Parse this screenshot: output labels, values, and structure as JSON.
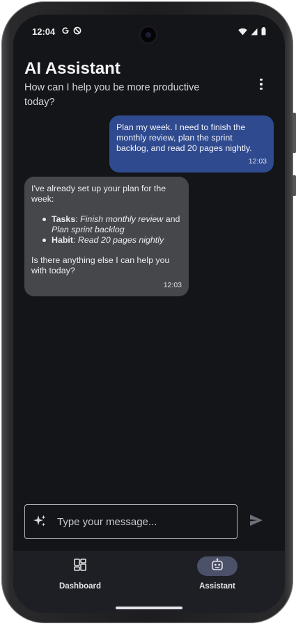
{
  "status_bar": {
    "time": "12:04",
    "left_icons": [
      "g-icon",
      "shield-icon"
    ],
    "right_icons": [
      "wifi-icon",
      "signal-icon",
      "battery-icon"
    ]
  },
  "header": {
    "title": "AI Assistant",
    "subtitle": "How can I help you be more productive today?",
    "menu_icon": "more-vert-icon"
  },
  "messages": [
    {
      "sender": "user",
      "text": "Plan my week. I need to finish the monthly review, plan the sprint backlog, and read 20 pages nightly.",
      "time": "12:03"
    },
    {
      "sender": "assistant",
      "intro": "I've already set up your plan for the week:",
      "items": [
        {
          "label": "Tasks",
          "sep": ": ",
          "part1": "Finish monthly review",
          "joiner": " and ",
          "part2": "Plan sprint backlog"
        },
        {
          "label": "Habit",
          "sep": ": ",
          "part1": "Read 20 pages nightly"
        }
      ],
      "outro": "Is there anything else I can help you with today?",
      "time": "12:03"
    }
  ],
  "composer": {
    "placeholder": "Type your message...",
    "value": "",
    "leading_icon": "sparkle-icon",
    "send_icon": "send-icon"
  },
  "bottom_nav": {
    "items": [
      {
        "label": "Dashboard",
        "icon": "dashboard-icon",
        "active": false
      },
      {
        "label": "Assistant",
        "icon": "robot-icon",
        "active": true
      }
    ]
  },
  "colors": {
    "background": "#141519",
    "user_bubble": "#2f4a8e",
    "assistant_bubble": "#46474b",
    "nav_active_pill": "#4b5168"
  }
}
